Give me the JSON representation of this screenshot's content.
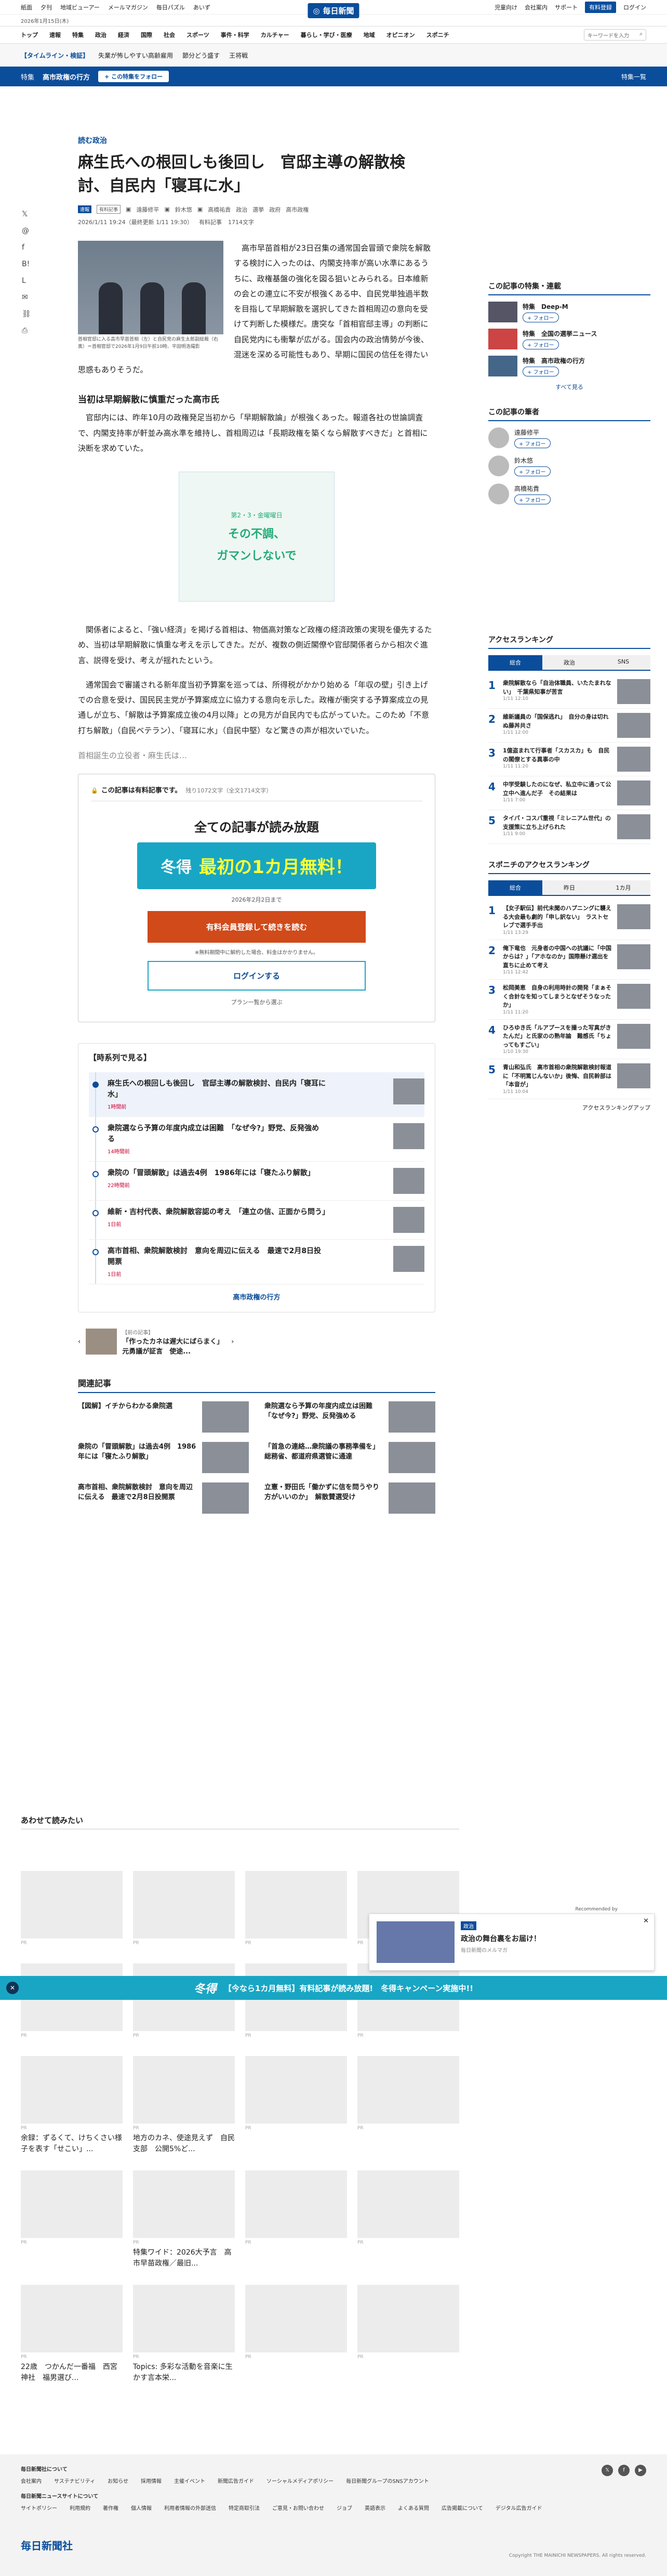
{
  "util": {
    "links": [
      "紙面",
      "夕刊",
      "地域ビューアー",
      "メールマガジン",
      "毎日パズル",
      "あいず"
    ],
    "logo": "毎日新聞",
    "right": [
      "児童向け",
      "会社案内",
      "サポート"
    ],
    "register": "有料登録",
    "login": "ログイン"
  },
  "date": "2026年1月15日(木)",
  "nav": [
    "トップ",
    "速報",
    "特集",
    "政治",
    "経済",
    "国際",
    "社会",
    "スポーツ",
    "事件・科学",
    "カルチャー",
    "暮らし・学び・医療",
    "地域",
    "オピニオン",
    "スポニチ"
  ],
  "search_placeholder": "キーワードを入力",
  "topics": [
    "【タイムライン・検証】",
    "失業が怖しやすい高齢雇用",
    "節分どう盛す",
    "王将戦"
  ],
  "tokushu": {
    "label": "特集",
    "title": "高市政権の行方",
    "follow": "+ この特集をフォロー",
    "more": "特集一覧"
  },
  "article": {
    "category": "読む政治",
    "title": "麻生氏への根回しも後回し　官邸主導の解散検討、自民内「寝耳に水」",
    "badges": [
      "速報",
      "有料記事"
    ],
    "authors": [
      "遠藤修平",
      "鈴木悠",
      "高橋祐貴"
    ],
    "tags": [
      "政治",
      "選挙",
      "政府",
      "高市政権"
    ],
    "date": "2026/1/11 19:24（最終更新 1/11 19:30）",
    "chars": "有料記事",
    "words": "1714文字",
    "caption": "首相官邸に入る高市早苗首相（左）と自民党の麻生太郎副総裁（右奥）＝首相官邸で2026年1月9日午前10時、平田明浩撮影",
    "p1": "高市早苗首相が23日召集の通常国会冒頭で衆院を解散する検討に入ったのは、内閣支持率が高い水準にあるうちに、政権基盤の強化を図る狙いとみられる。日本維新の会との連立に不安が根強くある中、自民党単独過半数を目指して早期解散を選択してきた首相周辺の意向を受けて判断した模様だ。唐突な「首相官邸主導」の判断に自民党内にも衝撃が広がる。国会内の政治情勢が今後、混迷を深める可能性もあり、早期に国民の信任を得たい思惑もありそうだ。",
    "h2": "当初は早期解散に慎重だった高市氏",
    "p2": "官邸内には、昨年10月の政権発足当初から「早期解散論」が根強くあった。報道各社の世論調査で、内閣支持率が軒並み高水準を維持し、首相周辺は「長期政権を築くなら解散すべきだ」と首相に決断を求めていた。",
    "p3": "関係者によると、「強い経済」を掲げる首相は、物価高対策など政権の経済政策の実現を優先するため、当初は早期解散に慎重な考えを示してきた。だが、複数の側近閣僚や官邸関係者らから相次ぐ進言、説得を受け、考えが揺れたという。",
    "p4": "通常国会で審議される新年度当初予算案を巡っては、所得税がかかり始める「年収の壁」引き上げでの合意を受け、国民民主党が予算案成立に協力する意向を示した。政権が衝突する予算案成立の見通しが立ち、「解散は予算案成立後の4月以降」との見方が自民内でも広がっていた。このため「不意打ち解散」（自民ベテラン）、「寝耳に水」（自民中堅）など驚きの声が相次いでいた。",
    "fade": "首相誕生の立役者・麻生氏は…"
  },
  "ad": {
    "line1": "第2・3・金曜曜日",
    "line2": "その不調、",
    "line3": "ガマンしないで"
  },
  "pay": {
    "notice": "この記事は有料記事です。",
    "remain": "残り1072文字（全文1714文字）",
    "title": "全ての記事が読み放題",
    "camp_k": "冬得",
    "camp_m": "最初の1カ月無料！",
    "camp_sub": "2026年2月2日まで",
    "register": "有料会員登録して続きを読む",
    "reg_note": "※無料期間中に解約した場合、料金はかかりません。",
    "login": "ログインする",
    "plans": "プラン一覧から選ぶ"
  },
  "timeline": {
    "title": "【時系列で見る】",
    "items": [
      {
        "t": "麻生氏への根回しも後回し　官邸主導の解散検討、自民内「寝耳に水」",
        "d": "1時間前"
      },
      {
        "t": "衆院選なら予算の年度内成立は困難　「なぜ今?」野党、反発強める",
        "d": "14時間前"
      },
      {
        "t": "衆院の「冒頭解散」は過去4例　1986年には「寝たふり解散」",
        "d": "22時間前"
      },
      {
        "t": "維新・吉村代表、衆院解散容認の考え　「連立の信、正面から問う」",
        "d": "1日前"
      },
      {
        "t": "高市首相、衆院解散検討　意向を周辺に伝える　最速で2月8日投開票",
        "d": "1日前"
      }
    ],
    "more": "高市政権の行方"
  },
  "prev": {
    "label": "【前の記事】",
    "title": "「作ったカネは遅大にばらまく」元勇議が証言　使途..."
  },
  "related": {
    "title": "関連記事",
    "items": [
      "【図解】イチからわかる衆院選",
      "衆院選なら予算の年度内成立は困難　「なぜ今?」野党、反発強める",
      "衆院の「冒頭解散」は過去4例　1986年には「寝たふり解散」",
      "",
      "「首急の連絡…衆院議の事務準備を」　総務省、都道府県選管に通達",
      "高市首相、衆院解散検討　意向を周辺に伝える　最速で2月8日投開票",
      "立憲・野田氏「働かずに信を問うやり方がいいのか」　解散賛選受け",
      ""
    ]
  },
  "side": {
    "feat_title": "この記事の特集・連載",
    "feats": [
      "特集　Deep-M",
      "特集　全国の選挙ニュース",
      "特集　高市政権の行方"
    ],
    "follow": "+ フォロー",
    "all": "すべて見る",
    "author_title": "この記事の筆者",
    "authors": [
      "遠藤修平",
      "鈴木悠",
      "高橋祐貴"
    ],
    "rank_title": "アクセスランキング",
    "tabs": [
      "総合",
      "政治",
      "SNS"
    ],
    "rank": [
      {
        "t": "衆院解散なら「自治体職員、いたたまれない」　千葉県知事が苦言",
        "ts": "1/11 12:10"
      },
      {
        "t": "維新議員の「国保逃れ」　自分の身は切れぬ藤丼共さ",
        "ts": "1/11 12:00"
      },
      {
        "t": "1億盗まれて行事者「スカスカ」も　自民の閣僚とする異事の中",
        "ts": "1/11 11:20"
      },
      {
        "t": "中学受験したのになぜ、私立中に通って公立中へ進んだ子　その結果は",
        "ts": "1/11 7:00"
      },
      {
        "t": "タイパ・コスパ重視「ミレニアム世代」の支援策に立ち上げられた",
        "ts": "1/11 9:00"
      }
    ],
    "sp_title": "スポニチのアクセスランキング",
    "sp_tabs": [
      "総合",
      "昨日",
      "1カ月"
    ],
    "sp_rank": [
      {
        "t": "【女子駅伝】前代未聞のハプニングに襲える大会最も劇的「申し訳ない」　ラストセレブで選手手出",
        "ts": "1/11 13:29"
      },
      {
        "t": "俺下竜也　元身者の中国への抗議に「中国からは？」「アホなのか」国際懸け選出を直ちに止めて考え",
        "ts": "1/11 12:42"
      },
      {
        "t": "松岡美恵　自身の利用時計の開発「まぁそく合計なを知ってしまうとなぜそうなったか」",
        "ts": "1/11 11:20"
      },
      {
        "t": "ひろゆき氏「ルアプースを撮った写真がきたんだ」と氏家のの熟年論　難感氏「ちょってもすごい」",
        "ts": "1/10 19:30"
      },
      {
        "t": "青山和弘氏　高市首相の衆院解散検討報道に「不明篤じんないか」後悔、自民幹部は「本音が」",
        "ts": "1/11 10:04"
      }
    ],
    "sp_more": "アクセスランキングアップ"
  },
  "reco": {
    "title": "あわせて読みたい",
    "pr": "PR",
    "items": [
      "",
      "",
      "",
      "",
      "",
      "",
      "",
      "",
      "余録：ずるくて、けちくさい様子を表す「せこい」...",
      "地方のカネ、使途見えず　自民支部　公開5%ど...",
      "",
      "",
      "",
      "特集ワイド：2026大予言　高市早苗政権／最旧...",
      "",
      "",
      "22歳　つかんだ一番福　西宮神社　福男選び...",
      "Topics: 多彩な活動を音楽に生かす言本栄...",
      "",
      ""
    ],
    "r2b": "　　自民党… 台　ひき逃げ容疑者「...",
    "logo": "毎日新聞"
  },
  "notif": {
    "rec": "Recommended by",
    "tag": "政治",
    "title": "政治の舞台裏をお届け！",
    "src": "毎日新聞のメルマガ"
  },
  "banner": {
    "k": "冬得",
    "text": "【今なら1カ月無料】有料記事が読み放題!　冬得キャンペーン実施中!!"
  },
  "footer": {
    "h1": "毎日新聞社について",
    "l1": [
      "会社案内",
      "サステナビリティ",
      "お知らせ",
      "採用情報",
      "主催イベント",
      "新聞広告ガイド",
      "ソーシャルメディアポリシー",
      "毎日新聞グループのSNSアカウント"
    ],
    "h2": "毎日新聞ニュースサイトについて",
    "l2": [
      "サイトポリシー",
      "利用規約",
      "著作権",
      "個人情報",
      "利用者情報の外部送信",
      "特定商取引法",
      "ご意見・お問い合わせ",
      "ジョブ",
      "英語表示",
      "よくある質問",
      "広告掲載について",
      "デジタル広告ガイド"
    ],
    "logo": "毎日新聞社",
    "copy": "Copyright THE MAINICHI NEWSPAPERS. All rights reserved."
  }
}
